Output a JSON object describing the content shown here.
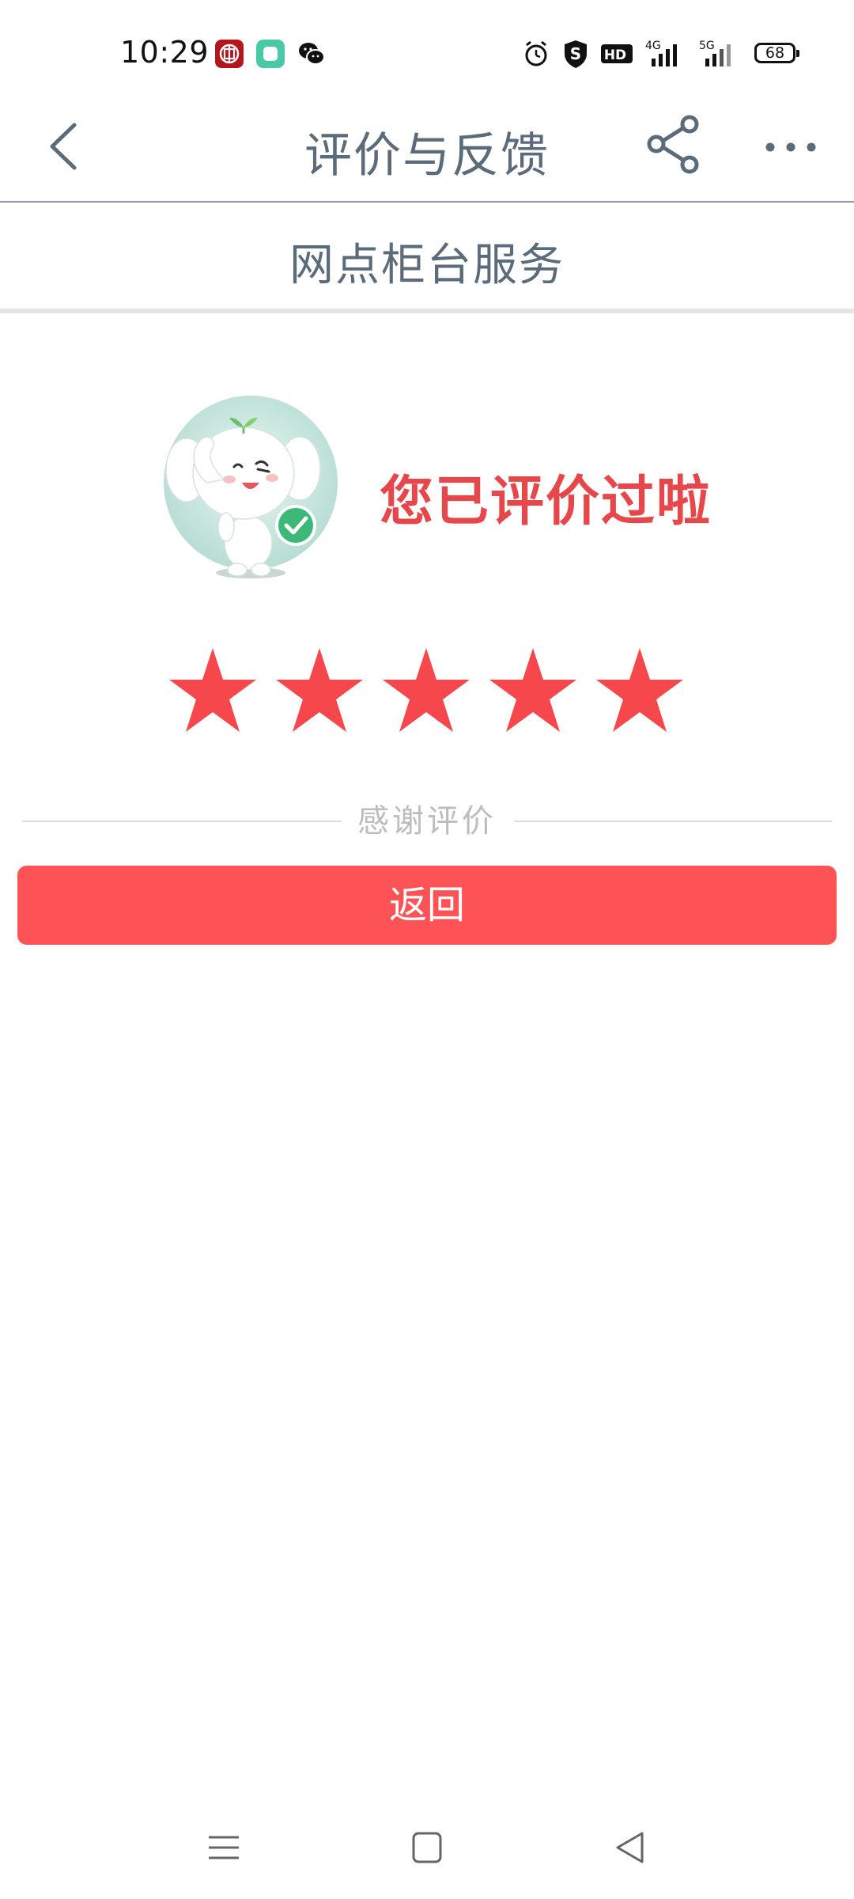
{
  "status_bar": {
    "time": "10:29",
    "battery_level": "68",
    "notifications": [
      "icbc-app-icon",
      "green-app-icon",
      "wechat-icon"
    ],
    "indicators": [
      "alarm-icon",
      "s-shield-icon",
      "hd-icon",
      "signal-4g-icon",
      "signal-5g-icon"
    ],
    "network_labels": {
      "lte": "4G",
      "nr": "5G",
      "hd": "HD"
    }
  },
  "header": {
    "title": "评价与反馈",
    "back_icon": "chevron-left-icon",
    "share_icon": "share-icon",
    "more_icon": "more-dots-icon"
  },
  "sub_header": {
    "title": "网点柜台服务"
  },
  "result": {
    "message": "您已评价过啦",
    "mascot": "elephant-mascot-checkmark",
    "rating": 5,
    "max_rating": 5,
    "thanks_text": "感谢评价"
  },
  "actions": {
    "return_label": "返回"
  },
  "nav_bar": {
    "items": [
      "menu-icon",
      "home-square-icon",
      "back-triangle-icon"
    ]
  },
  "colors": {
    "accent": "#fd5256",
    "star": "#f5474c",
    "message": "#e5474b",
    "title_text": "#5c6b7a",
    "mascot_bg": "#cde8e2"
  }
}
